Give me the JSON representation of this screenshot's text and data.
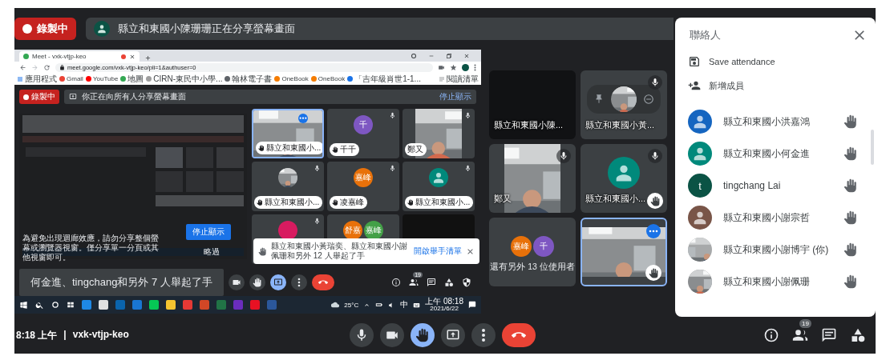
{
  "recording_badge": "錄製中",
  "presenter_banner": "縣立和東國小陳珊珊正在分享螢幕畫面",
  "shared_screen": {
    "browser": {
      "tab_title": "Meet - vxk-vtjp-keo",
      "url": "meet.google.com/vxk-vtjp-keo/pli=1&authuser=0",
      "bookmarks": [
        "應用程式",
        "Gmail",
        "YouTube",
        "地圖",
        "CIRN-東民中小學...",
        "翰林電子書",
        "OneBook",
        "OneBook",
        "「吉年級肖世1-1..."
      ],
      "reading_list": "閱讀清單"
    },
    "recording_badge": "錄製中",
    "banner": "你正在向所有人分享螢幕畫面",
    "banner_link": "停止顯示",
    "warning": "為避免出現迴廊效應，請勿分享整個螢幕或瀏覽器視窗。僅分享單一分頁或其他視窗即可。",
    "stop_button": "停止顯示",
    "dismiss": "略過",
    "tiles": [
      {
        "kind": "video",
        "label": "縣立和東國小...",
        "selected": true,
        "muted": false,
        "hand_raised": true
      },
      {
        "kind": "avatar",
        "avatars": [
          {
            "initial": "千",
            "color": "#7e57c2"
          }
        ],
        "label": "千千",
        "selected": false,
        "muted": true,
        "hand_raised": true
      },
      {
        "kind": "video",
        "label": "鄭又",
        "selected": false,
        "muted": true,
        "hand_raised": false
      },
      {
        "label": "縣立和東國小...",
        "selected": false,
        "muted": true,
        "hand_raised": true
      },
      {
        "kind": "avatar",
        "avatars": [
          {
            "initial": "嘉峰",
            "color": "#e8710a"
          }
        ],
        "label": "凌嘉峰",
        "selected": false,
        "muted": true,
        "hand_raised": true
      },
      {
        "kind": "silhouette",
        "avatars": [
          {
            "color": "#00897b"
          }
        ],
        "label": "縣立和東國小...",
        "selected": false,
        "muted": true,
        "hand_raised": true
      },
      {
        "kind": "avatar",
        "avatars": [
          {
            "color": "#d81b60"
          }
        ],
        "selected": false,
        "muted": true
      },
      {
        "kind": "avatar",
        "avatars": [
          {
            "initial": "舒嘉",
            "color": "#e8710a"
          },
          {
            "initial": "嘉峰",
            "color": "#43a047"
          }
        ],
        "selected": false,
        "muted": false
      },
      {
        "kind": "blank",
        "selected": false,
        "muted": false
      }
    ],
    "notification": {
      "text": "縣立和東國小黃瑞奕、縣立和東國小謝佩珊和另外 12 人舉起了手",
      "link": "開啟舉手清單"
    },
    "hands_toast": "何金進、tingchang和另外 7 人舉起了手",
    "controls": [
      {
        "kind": "camera",
        "active": false
      },
      {
        "kind": "hand",
        "active": false
      },
      {
        "kind": "present",
        "active": true
      },
      {
        "kind": "more",
        "active": false
      },
      {
        "kind": "leave",
        "active": false
      }
    ],
    "side_buttons": [
      {
        "kind": "info"
      },
      {
        "kind": "people",
        "badge": "19"
      },
      {
        "kind": "chat"
      },
      {
        "kind": "activities"
      },
      {
        "kind": "safety"
      }
    ],
    "taskbar": {
      "weather": "25°C",
      "ime": "中",
      "time": "上午 08:18",
      "date": "2021/6/22"
    }
  },
  "tiles": [
    {
      "kind": "blank",
      "label": "縣立和東國小陳...",
      "selected": false,
      "muted": false,
      "hand_raised": false,
      "hovered": false
    },
    {
      "label": "縣立和東國小黃...",
      "selected": false,
      "muted": true,
      "hand_raised": false,
      "hovered": true
    },
    {
      "kind": "video",
      "label": "鄭又",
      "selected": false,
      "muted": true,
      "hand_raised": false,
      "hovered": false
    },
    {
      "kind": "silhouette",
      "color": "#00897b",
      "label": "縣立和東國小...",
      "selected": false,
      "muted": true,
      "hand_raised": true,
      "hovered": false
    },
    {
      "kind": "overflow",
      "avatars": [
        {
          "initial": "嘉峰",
          "color": "#e8710a"
        },
        {
          "initial": "千",
          "color": "#7e57c2"
        }
      ],
      "label": "還有另外 13 位使用者",
      "selected": false,
      "muted": false,
      "hand_raised": false,
      "hovered": false
    },
    {
      "kind": "video",
      "selected": true,
      "muted": false,
      "hand_raised": true,
      "hovered": false
    }
  ],
  "clock": "8:18 上午",
  "clock_separator": "|",
  "meeting_code": "vxk-vtjp-keo",
  "controls": [
    {
      "kind": "mic",
      "active": false
    },
    {
      "kind": "camera",
      "active": false
    },
    {
      "kind": "hand",
      "active": true
    },
    {
      "kind": "present",
      "active": false
    },
    {
      "kind": "more",
      "active": false
    },
    {
      "kind": "leave",
      "active": false
    }
  ],
  "side_buttons": [
    {
      "kind": "info"
    },
    {
      "kind": "people",
      "badge": "19"
    },
    {
      "kind": "chat"
    },
    {
      "kind": "activities"
    }
  ],
  "panel": {
    "title": "聯絡人",
    "actions": [
      {
        "kind": "save",
        "label": "Save attendance"
      },
      {
        "kind": "add",
        "label": "新增成員"
      }
    ],
    "people": [
      {
        "kind": "silhouette",
        "color": "#1565c0",
        "name": "縣立和東國小洪嘉鴻",
        "hand_raised": true
      },
      {
        "kind": "silhouette",
        "color": "#00897b",
        "name": "縣立和東國小何金進",
        "hand_raised": true
      },
      {
        "kind": "letter",
        "letter": "t",
        "color": "#0b5345",
        "name": "tingchang Lai",
        "hand_raised": true
      },
      {
        "kind": "silhouette",
        "color": "#795548",
        "name": "縣立和東國小謝宗哲",
        "hand_raised": true
      },
      {
        "name": "縣立和東國小謝博宇 (你)",
        "hand_raised": true
      },
      {
        "name": "縣立和東國小謝佩珊",
        "hand_raised": true
      }
    ]
  }
}
